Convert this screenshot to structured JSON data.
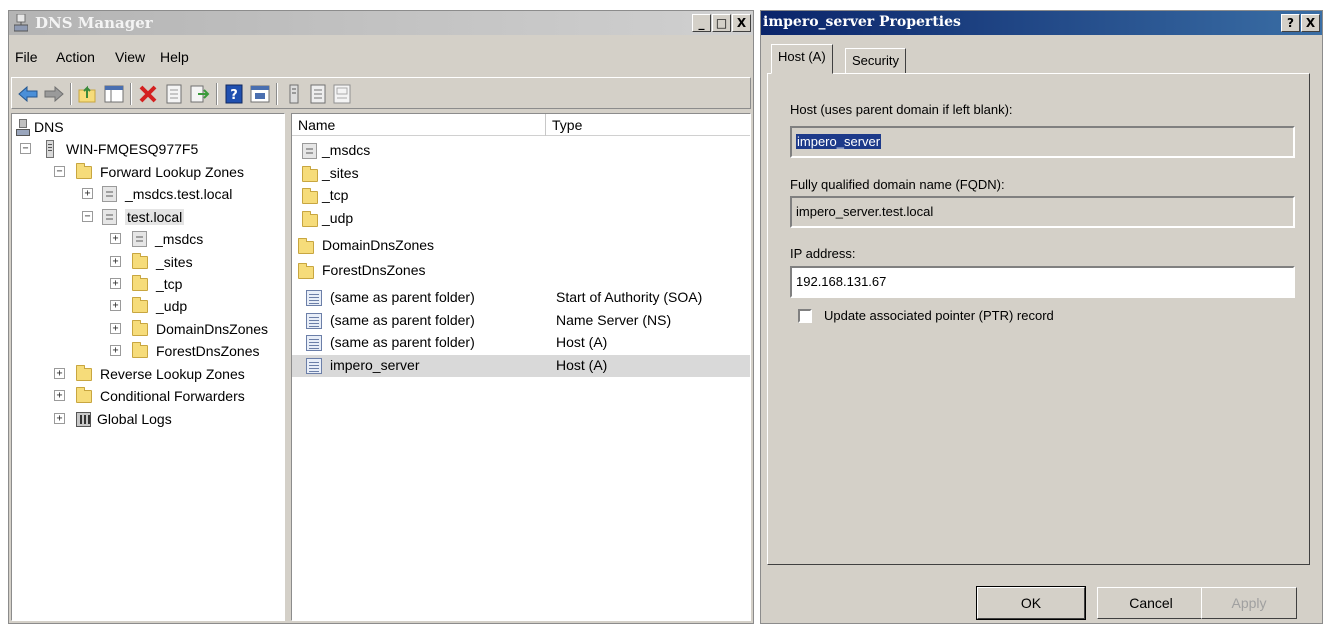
{
  "dns_manager": {
    "title": "DNS Manager",
    "window_buttons": {
      "minimize": "_",
      "maximize": "□",
      "close": "X"
    },
    "menu": [
      "File",
      "Action",
      "View",
      "Help"
    ],
    "toolbar_icons": [
      "back-arrow-icon",
      "forward-arrow-icon",
      "up-folder-icon",
      "show-console-tree-icon",
      "delete-icon",
      "properties-icon",
      "export-icon",
      "help-icon",
      "console-icon",
      "server-icon",
      "list-icon",
      "details-icon"
    ],
    "tree": [
      {
        "label": "DNS",
        "icon": "dns-icon"
      },
      {
        "label": "WIN-FMQESQ977F5",
        "icon": "server-icon",
        "expander": "−"
      },
      {
        "label": "Forward Lookup Zones",
        "icon": "folder-icon",
        "expander": "−"
      },
      {
        "label": "_msdcs.test.local",
        "icon": "zone-icon",
        "expander": "+"
      },
      {
        "label": "test.local",
        "icon": "zone-icon",
        "expander": "−"
      },
      {
        "label": "_msdcs",
        "icon": "zone-icon",
        "expander": "+"
      },
      {
        "label": "_sites",
        "icon": "folder-icon",
        "expander": "+"
      },
      {
        "label": "_tcp",
        "icon": "folder-icon",
        "expander": "+"
      },
      {
        "label": "_udp",
        "icon": "folder-icon",
        "expander": "+"
      },
      {
        "label": "DomainDnsZones",
        "icon": "folder-icon",
        "expander": "+"
      },
      {
        "label": "ForestDnsZones",
        "icon": "folder-icon",
        "expander": "+"
      },
      {
        "label": "Reverse Lookup Zones",
        "icon": "folder-icon",
        "expander": "+"
      },
      {
        "label": "Conditional Forwarders",
        "icon": "folder-icon",
        "expander": "+"
      },
      {
        "label": "Global Logs",
        "icon": "logs-icon",
        "expander": "+"
      }
    ],
    "list": {
      "columns": [
        "Name",
        "Type"
      ],
      "rows": [
        {
          "name": "_msdcs",
          "type": "",
          "icon": "zone-icon"
        },
        {
          "name": "_sites",
          "type": "",
          "icon": "folder-icon"
        },
        {
          "name": "_tcp",
          "type": "",
          "icon": "folder-icon"
        },
        {
          "name": "_udp",
          "type": "",
          "icon": "folder-icon"
        },
        {
          "name": "DomainDnsZones",
          "type": "",
          "icon": "folder-icon"
        },
        {
          "name": "ForestDnsZones",
          "type": "",
          "icon": "folder-icon"
        },
        {
          "name": "(same as parent folder)",
          "type": "Start of Authority (SOA)",
          "icon": "record-icon"
        },
        {
          "name": "(same as parent folder)",
          "type": "Name Server (NS)",
          "icon": "record-icon"
        },
        {
          "name": "(same as parent folder)",
          "type": "Host (A)",
          "icon": "record-icon"
        },
        {
          "name": "impero_server",
          "type": "Host (A)",
          "icon": "record-icon",
          "selected": true
        }
      ]
    }
  },
  "properties": {
    "title": "impero_server Properties",
    "title_buttons": {
      "help": "?",
      "close": "X"
    },
    "tabs": [
      "Host (A)",
      "Security"
    ],
    "host_label": "Host (uses parent domain if left blank):",
    "host_value": "impero_server",
    "fqdn_label": "Fully qualified domain name (FQDN):",
    "fqdn_value": "impero_server.test.local",
    "ip_label": "IP address:",
    "ip_value": "192.168.131.67",
    "ptr_label": "Update associated pointer (PTR) record",
    "ptr_checked": false,
    "buttons": {
      "ok": "OK",
      "cancel": "Cancel",
      "apply": "Apply"
    }
  }
}
